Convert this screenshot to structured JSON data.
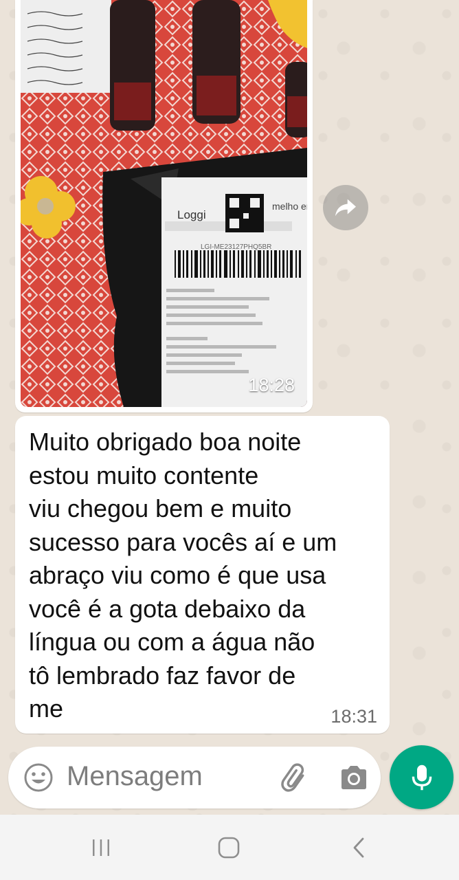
{
  "chat": {
    "messages": [
      {
        "type": "image",
        "time": "18:28"
      },
      {
        "type": "text",
        "text": "Muito obrigado boa noite\nestou muito contente\nviu chegou bem e muito\nsucesso para vocês aí e um\nabraço viu como é que usa\nvocê é a gota debaixo da\nlíngua ou com a água não\ntô lembrado faz favor de\nme",
        "time": "18:31"
      }
    ],
    "photo_labels": {
      "brand": "Loggi",
      "partner": "melho env",
      "tracking": "LGI-ME23127PHQ5BR"
    }
  },
  "composer": {
    "placeholder": "Mensagem",
    "icons": [
      "emoji-icon",
      "attach-icon",
      "camera-icon",
      "mic-icon"
    ]
  },
  "navigation": {
    "icons": [
      "recents-icon",
      "home-icon",
      "back-icon"
    ]
  },
  "colors": {
    "wallpaper": "#EBE3D9",
    "bubble": "#FFFFFF",
    "accent": "#00A884",
    "navbar": "#F4F4F4"
  }
}
